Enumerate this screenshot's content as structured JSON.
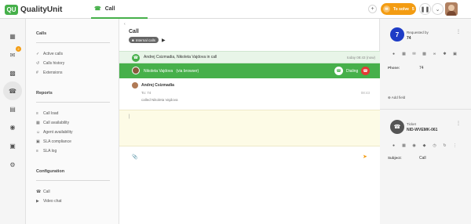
{
  "header": {
    "logo_badge": "QU",
    "logo_text": "QualityUnit",
    "active_tab": "Call",
    "status_pill": {
      "label": "To solve",
      "count": "5"
    },
    "plus_label": "+"
  },
  "rail": {
    "icons": [
      "dashboard-icon",
      "mail-icon",
      "chat-icon",
      "phone-icon",
      "tickets-icon",
      "contacts-icon",
      "building-icon",
      "gear-icon"
    ],
    "mail_badge": "2"
  },
  "menu": {
    "calls_title": "Calls",
    "calls_items": [
      {
        "icon": "✓",
        "label": "Active calls"
      },
      {
        "icon": "↺",
        "label": "Calls history"
      },
      {
        "icon": "#",
        "label": "Extensions"
      }
    ],
    "reports_title": "Reports",
    "reports_items": [
      {
        "icon": "≡",
        "label": "Call load"
      },
      {
        "icon": "▦",
        "label": "Call availability"
      },
      {
        "icon": "☺",
        "label": "Agent availability"
      },
      {
        "icon": "▣",
        "label": "SLA compliance"
      },
      {
        "icon": "≡",
        "label": "SLA log"
      }
    ],
    "config_title": "Configuration",
    "config_items": [
      {
        "icon": "☎",
        "label": "Call"
      },
      {
        "icon": "▶",
        "label": "Video chat"
      }
    ]
  },
  "main": {
    "back": "‹",
    "title": "Call",
    "tag": "Internal calls",
    "event_bar": {
      "text": "Andrej Csizmadia, Nikoleta Vajdova in call",
      "time": "today 08:43 (now)"
    },
    "dial_bar": {
      "name": "Nikoleta Vajdova",
      "via": "(via browser)",
      "status": "Dialing"
    },
    "message": {
      "name": "Andrej Csizmadia",
      "to": "To: 74",
      "time": "08:43",
      "body": "called Nikoleta Vajdova"
    }
  },
  "right": {
    "requester_number": "7",
    "requested_by_label": "Requested by",
    "requested_by_value": "74",
    "phone_label": "Phone:",
    "phone_value": "74",
    "add_field": "Add field",
    "ticket_label": "Ticket",
    "ticket_id": "NID-WVEMK-061",
    "subject_label": "Subject:",
    "subject_value": "Call"
  }
}
